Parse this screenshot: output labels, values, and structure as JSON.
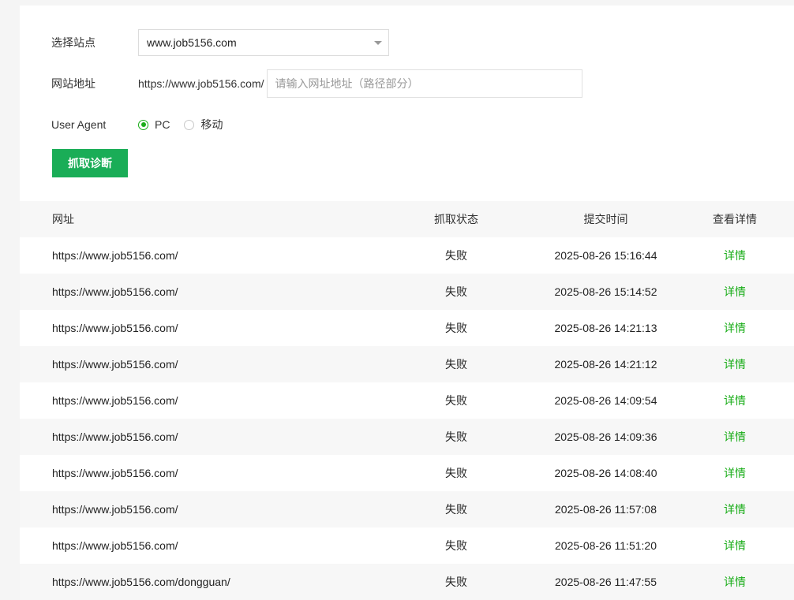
{
  "form": {
    "site_label": "选择站点",
    "site_value": "www.job5156.com",
    "url_label": "网站地址",
    "url_prefix": "https://www.job5156.com/",
    "url_placeholder": "请输入网址地址（路径部分）",
    "ua_label": "User Agent",
    "ua_options": [
      {
        "label": "PC",
        "checked": true
      },
      {
        "label": "移动",
        "checked": false
      }
    ],
    "submit_label": "抓取诊断"
  },
  "table": {
    "headers": {
      "url": "网址",
      "status": "抓取状态",
      "time": "提交时间",
      "detail": "查看详情"
    },
    "rows": [
      {
        "url": "https://www.job5156.com/",
        "status": "失败",
        "time": "2025-08-26 15:16:44",
        "detail": "详情"
      },
      {
        "url": "https://www.job5156.com/",
        "status": "失败",
        "time": "2025-08-26 15:14:52",
        "detail": "详情"
      },
      {
        "url": "https://www.job5156.com/",
        "status": "失败",
        "time": "2025-08-26 14:21:13",
        "detail": "详情"
      },
      {
        "url": "https://www.job5156.com/",
        "status": "失败",
        "time": "2025-08-26 14:21:12",
        "detail": "详情"
      },
      {
        "url": "https://www.job5156.com/",
        "status": "失败",
        "time": "2025-08-26 14:09:54",
        "detail": "详情"
      },
      {
        "url": "https://www.job5156.com/",
        "status": "失败",
        "time": "2025-08-26 14:09:36",
        "detail": "详情"
      },
      {
        "url": "https://www.job5156.com/",
        "status": "失败",
        "time": "2025-08-26 14:08:40",
        "detail": "详情"
      },
      {
        "url": "https://www.job5156.com/",
        "status": "失败",
        "time": "2025-08-26 11:57:08",
        "detail": "详情"
      },
      {
        "url": "https://www.job5156.com/",
        "status": "失败",
        "time": "2025-08-26 11:51:20",
        "detail": "详情"
      },
      {
        "url": "https://www.job5156.com/dongguan/",
        "status": "失败",
        "time": "2025-08-26 11:47:55",
        "detail": "详情"
      }
    ]
  },
  "colors": {
    "accent": "#1aad19",
    "button": "#1aad57"
  }
}
